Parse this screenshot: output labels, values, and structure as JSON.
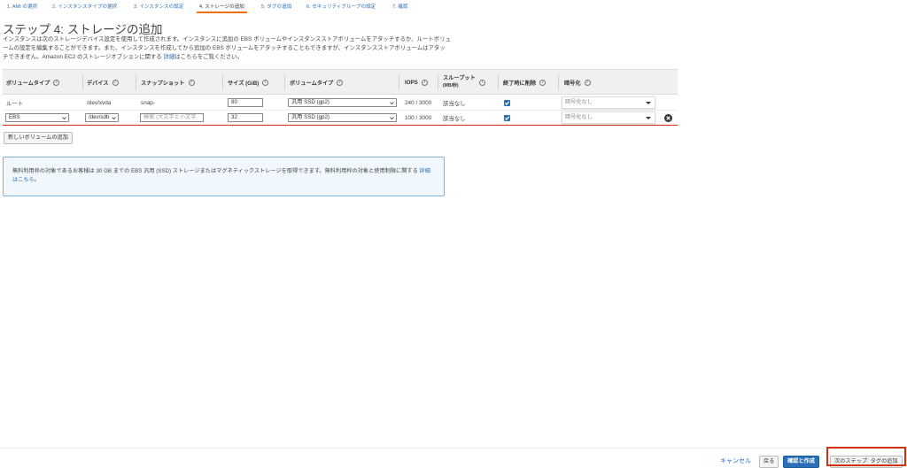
{
  "tabs": [
    {
      "label": "1. AMI の選択"
    },
    {
      "label": "2. インスタンスタイプの選択"
    },
    {
      "label": "3. インスタンスの設定"
    },
    {
      "label": "4. ストレージの追加"
    },
    {
      "label": "5. タグの追加"
    },
    {
      "label": "6. セキュリティグループの設定"
    },
    {
      "label": "7. 確認"
    }
  ],
  "page": {
    "title": "ステップ 4: ストレージの追加",
    "description": "インスタンスは次のストレージデバイス設定を使用して作成されます。インスタンスに追加の EBS ボリュームやインスタンスストアボリュームをアタッチするか、ルートボリュームの設定を編集することができます。また、インスタンスを作成してから追加の EBS ボリュームをアタッチすることもできますが、インスタンスストアボリュームはアタッチできません。Amazon EC2 のストレージオプションに関する",
    "desc_link": "詳細",
    "desc_suffix": "はこちらをご覧ください。"
  },
  "table": {
    "headers": {
      "volume_type": "ボリュームタイプ",
      "device": "デバイス",
      "snapshot": "スナップショット",
      "size": "サイズ (GiB)",
      "vol_kind": "ボリュームタイプ",
      "iops": "IOPS",
      "throughput_1": "スループット",
      "throughput_2": "(MB/秒)",
      "delete": "終了時に削除",
      "encryption": "暗号化"
    },
    "rows": [
      {
        "volume_type": "ルート",
        "device": "/dev/xvda",
        "snapshot": "snap-",
        "size": "80",
        "vol_kind": "汎用 SSD (gp2)",
        "iops": "240 / 3000",
        "throughput": "該当なし",
        "delete": true,
        "encryption": "暗号化なし"
      },
      {
        "volume_type": "EBS",
        "device": "/dev/sdb",
        "snapshot_placeholder": "検索 (大文字と小文字",
        "size": "32",
        "vol_kind": "汎用 SSD (gp2)",
        "iops": "100 / 3000",
        "throughput": "該当なし",
        "delete": true,
        "encryption": "暗号化なし"
      }
    ]
  },
  "add_volume_label": "新しいボリュームの追加",
  "notice": {
    "text": "無料利用枠の対象であるお客様は 30 GB までの EBS 汎用 (SSD) ストレージまたはマグネティックストレージを取得できます。無料利用枠の対象と使用制限に関する",
    "link": "詳細はこちら",
    "suffix": "。"
  },
  "footer": {
    "cancel": "キャンセル",
    "back": "戻る",
    "review": "確認と作成",
    "next": "次のステップ: タグの追加"
  },
  "colors": {
    "accent": "#2a6fb8",
    "active_tab": "#ec7211",
    "highlight": "#d13212"
  }
}
